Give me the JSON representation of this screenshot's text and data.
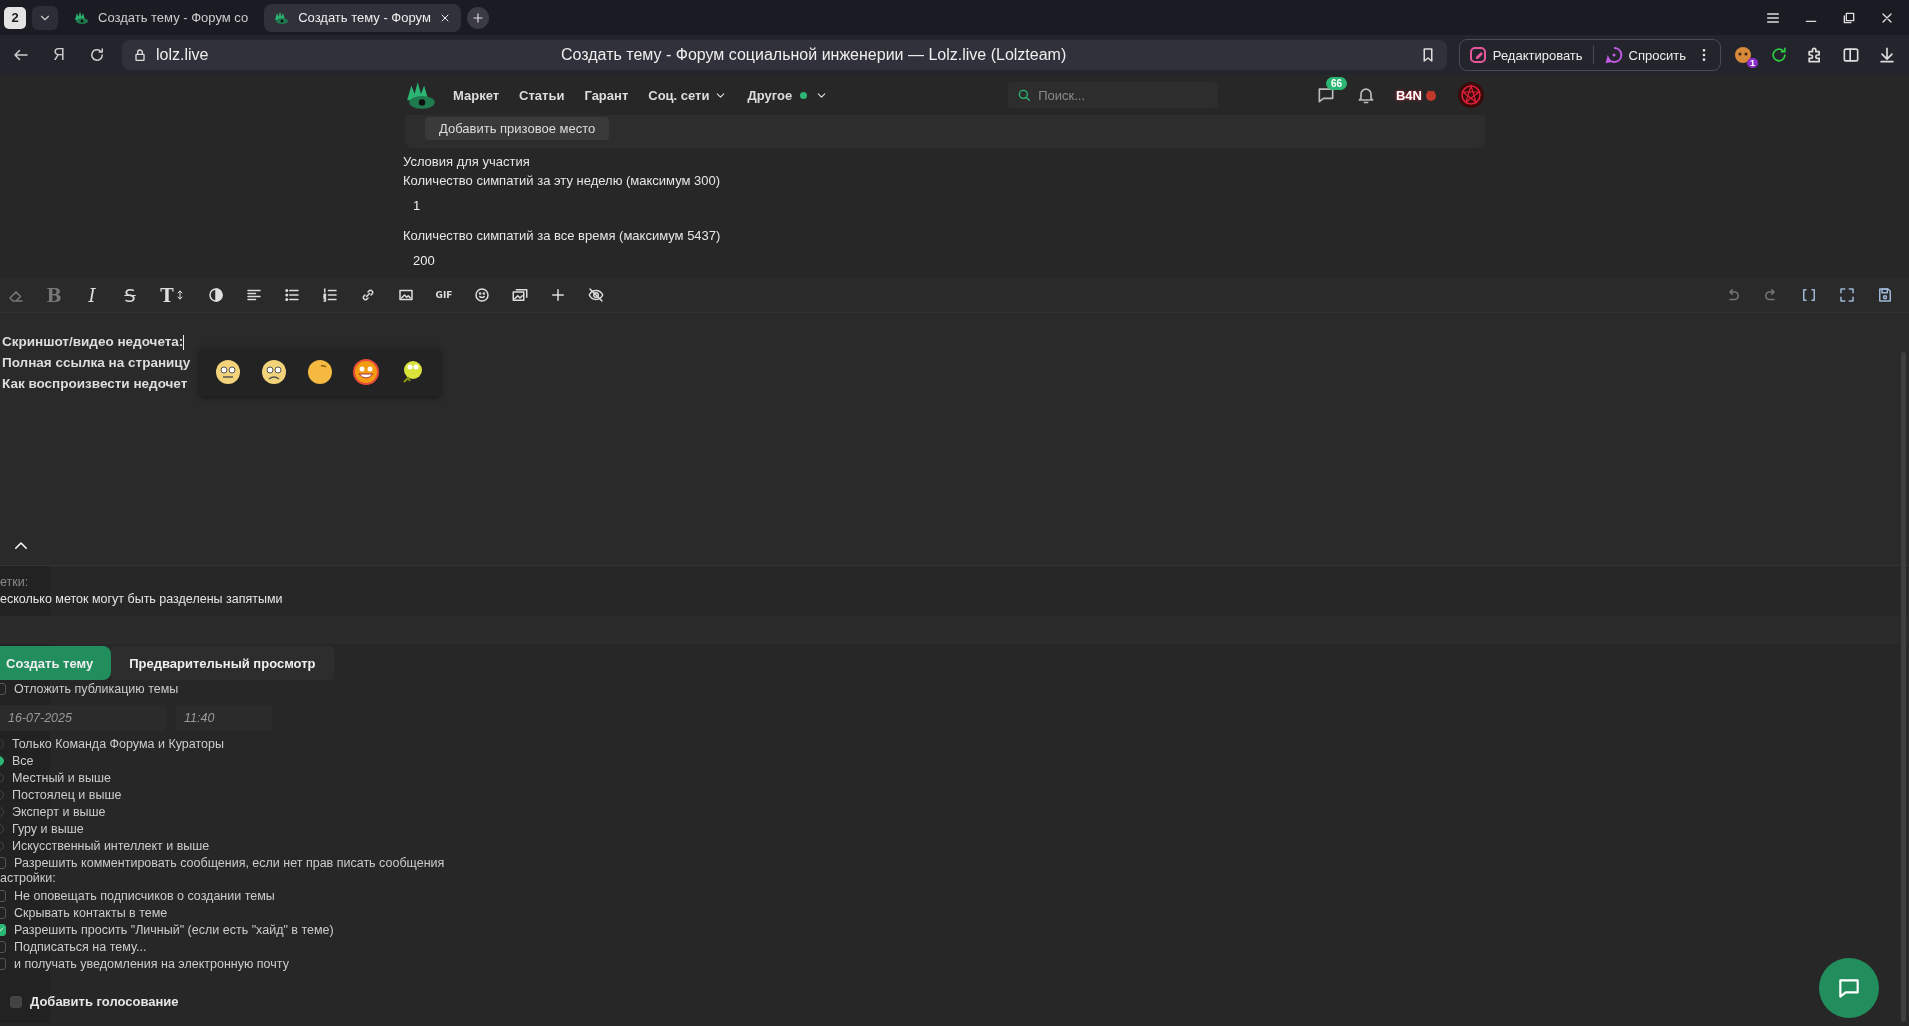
{
  "browser": {
    "tab_count": "2",
    "tabs": [
      {
        "title": "Создать тему - Форум со",
        "selected": false
      },
      {
        "title": "Создать тему - Форум",
        "selected": true
      }
    ],
    "home_glyph": "Я",
    "address": "lolz.live",
    "page_title": "Создать тему - Форум социальной инженерии — Lolz.live (Lolzteam)",
    "actions": [
      "Редактировать",
      "Спросить"
    ],
    "extension_badge": "1"
  },
  "site_nav": {
    "items": [
      {
        "label": "Маркет",
        "dropdown": false,
        "dot": false
      },
      {
        "label": "Статьи",
        "dropdown": false,
        "dot": false
      },
      {
        "label": "Гарант",
        "dropdown": false,
        "dot": false
      },
      {
        "label": "Соц. сети",
        "dropdown": true,
        "dot": false
      },
      {
        "label": "Другое",
        "dropdown": true,
        "dot": true
      }
    ],
    "search": {
      "placeholder": "Поиск..."
    },
    "messages_badge": "66",
    "user_tag": "B4N"
  },
  "prize_button": "Добавить призовое место",
  "conditions": {
    "title": "Условия для участия",
    "fields": [
      {
        "label": "Количество симпатий за эту неделю (максимум 300)",
        "value": "1"
      },
      {
        "label": "Количество симпатий за все время (максимум 5437)",
        "value": "200"
      }
    ]
  },
  "editor": {
    "toolbar": {
      "bold": "B",
      "italic": "I",
      "strike": "S",
      "size": "T",
      "gif": "GIF"
    },
    "lines": [
      "Скриншот/видео недочета:",
      "Полная ссылка на страницу",
      "Как воспроизвести недочет"
    ]
  },
  "tags": {
    "label": "етки:",
    "hint": "есколько меток могут быть разделены запятыми"
  },
  "buttons": [
    {
      "label": "Создать тему",
      "kind": "primary"
    },
    {
      "label": "Предварительный просмотр",
      "kind": "secondary"
    }
  ],
  "schedule": {
    "label": "Отложить публикацию темы",
    "checked": false,
    "date": {
      "placeholder": "16-07-2025"
    },
    "time": {
      "placeholder": "11:40"
    }
  },
  "reply_access": [
    {
      "label": "Только Команда Форума и Кураторы",
      "selected": false
    },
    {
      "label": "Все",
      "selected": true
    },
    {
      "label": "Местный и выше",
      "selected": false
    },
    {
      "label": "Постоялец и выше",
      "selected": false
    },
    {
      "label": "Эксперт и выше",
      "selected": false
    },
    {
      "label": "Гуру и выше",
      "selected": false
    },
    {
      "label": "Искусственный интеллект и выше",
      "selected": false
    }
  ],
  "allow_comments": {
    "label": "Разрешить комментировать сообщения, если нет прав писать сообщения",
    "checked": false
  },
  "settings": {
    "title": "астройки:",
    "options": [
      {
        "label": "Не оповещать подписчиков о создании темы",
        "checked": false
      },
      {
        "label": "Скрывать контакты в теме",
        "checked": false
      },
      {
        "label": "Разрешить просить \"Личный\" (если есть \"хайд\" в теме)",
        "checked": true
      },
      {
        "label": "Подписаться на тему...",
        "checked": false
      },
      {
        "label": "и получать уведомления на электронную почту",
        "checked": false
      }
    ]
  },
  "poll": {
    "label": "Добавить голосование",
    "checked": false
  }
}
